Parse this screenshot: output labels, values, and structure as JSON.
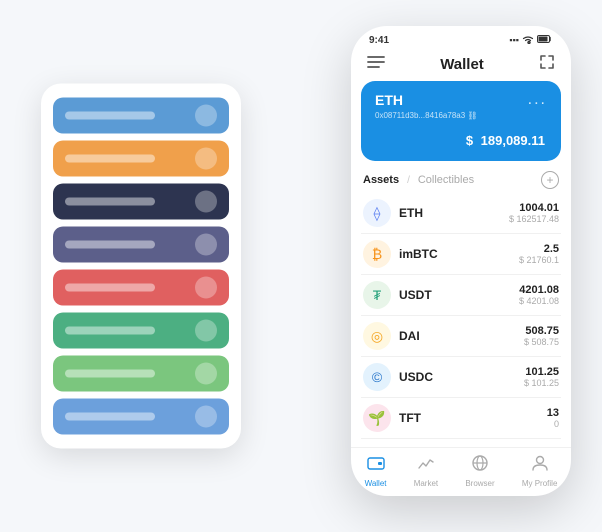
{
  "scene": {
    "background": "#f5f7fa"
  },
  "cardStack": {
    "cards": [
      {
        "id": "card-blue",
        "color": "#5b9bd5",
        "iconText": "◈"
      },
      {
        "id": "card-orange",
        "color": "#f0a04b",
        "iconText": "◈"
      },
      {
        "id": "card-dark",
        "color": "#2d3450",
        "iconText": "◈"
      },
      {
        "id": "card-purple",
        "color": "#5c5f8a",
        "iconText": "◈"
      },
      {
        "id": "card-red",
        "color": "#e06060",
        "iconText": "◈"
      },
      {
        "id": "card-green",
        "color": "#4caf82",
        "iconText": "◈"
      },
      {
        "id": "card-lightgreen",
        "color": "#7bc67e",
        "iconText": "◈"
      },
      {
        "id": "card-cornflower",
        "color": "#6ca0dc",
        "iconText": "◈"
      }
    ]
  },
  "phone": {
    "statusBar": {
      "time": "9:41",
      "signal": "▪▪▪",
      "wifi": "WiFi",
      "battery": "🔋"
    },
    "navBar": {
      "menuIcon": "☰",
      "title": "Wallet",
      "expandIcon": "⤢"
    },
    "ethCard": {
      "title": "ETH",
      "address": "0x08711d3b...8416a78a3  ⛓",
      "menu": "...",
      "balanceSymbol": "$",
      "balance": "189,089.11"
    },
    "assetsSection": {
      "activeTab": "Assets",
      "divider": "/",
      "inactiveTab": "Collectibles",
      "addIcon": "+"
    },
    "assets": [
      {
        "id": "eth",
        "name": "ETH",
        "iconText": "⟠",
        "iconClass": "icon-eth",
        "amountMain": "1004.01",
        "amountUsd": "$ 162517.48"
      },
      {
        "id": "imbtc",
        "name": "imBTC",
        "iconText": "₿",
        "iconClass": "icon-imbtc",
        "amountMain": "2.5",
        "amountUsd": "$ 21760.1"
      },
      {
        "id": "usdt",
        "name": "USDT",
        "iconText": "₮",
        "iconClass": "icon-usdt",
        "amountMain": "4201.08",
        "amountUsd": "$ 4201.08"
      },
      {
        "id": "dai",
        "name": "DAI",
        "iconText": "◎",
        "iconClass": "icon-dai",
        "amountMain": "508.75",
        "amountUsd": "$ 508.75"
      },
      {
        "id": "usdc",
        "name": "USDC",
        "iconText": "©",
        "iconClass": "icon-usdc",
        "amountMain": "101.25",
        "amountUsd": "$ 101.25"
      },
      {
        "id": "tft",
        "name": "TFT",
        "iconText": "🌱",
        "iconClass": "icon-tft",
        "amountMain": "13",
        "amountUsd": "0"
      }
    ],
    "bottomNav": [
      {
        "id": "wallet",
        "icon": "◎",
        "label": "Wallet",
        "active": true
      },
      {
        "id": "market",
        "icon": "📈",
        "label": "Market",
        "active": false
      },
      {
        "id": "browser",
        "icon": "🌐",
        "label": "Browser",
        "active": false
      },
      {
        "id": "profile",
        "icon": "👤",
        "label": "My Profile",
        "active": false
      }
    ]
  }
}
